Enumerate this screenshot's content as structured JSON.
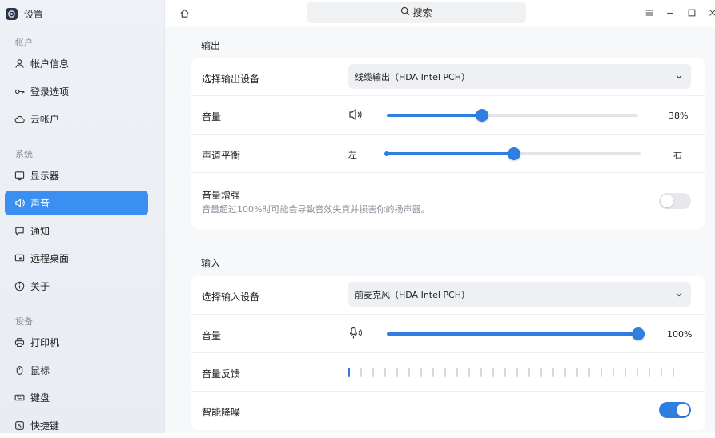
{
  "app": {
    "name": "设置"
  },
  "sidebar": {
    "groups": [
      {
        "label": "帐户",
        "items": [
          {
            "label": "帐户信息",
            "icon": "user-icon"
          },
          {
            "label": "登录选项",
            "icon": "key-icon"
          },
          {
            "label": "云帐户",
            "icon": "cloud-icon"
          }
        ]
      },
      {
        "label": "系统",
        "items": [
          {
            "label": "显示器",
            "icon": "monitor-icon"
          },
          {
            "label": "声音",
            "icon": "speaker-icon",
            "active": true
          },
          {
            "label": "通知",
            "icon": "chat-bubble-icon"
          },
          {
            "label": "远程桌面",
            "icon": "remote-desktop-icon"
          },
          {
            "label": "关于",
            "icon": "info-icon"
          }
        ]
      },
      {
        "label": "设备",
        "items": [
          {
            "label": "打印机",
            "icon": "printer-icon"
          },
          {
            "label": "鼠标",
            "icon": "mouse-icon"
          },
          {
            "label": "键盘",
            "icon": "keyboard-icon"
          },
          {
            "label": "快捷键",
            "icon": "shortcut-icon"
          }
        ]
      }
    ]
  },
  "topbar": {
    "search_placeholder": "搜索"
  },
  "output": {
    "title": "输出",
    "device_label": "选择输出设备",
    "device_value": "线缆输出（HDA Intel PCH）",
    "volume_label": "音量",
    "volume_value": "38%",
    "volume_level": 0.38,
    "balance_label": "声道平衡",
    "balance_left": "左",
    "balance_right": "右",
    "balance_level": 0.5,
    "boost_label": "音量增强",
    "boost_desc": "音量超过100%时可能会导致音效失真并损害你的扬声器。",
    "boost_on": false
  },
  "input": {
    "title": "输入",
    "device_label": "选择输入设备",
    "device_value": "前麦克风（HDA Intel PCH）",
    "volume_label": "音量",
    "volume_value": "100%",
    "volume_level": 1.0,
    "feedback_label": "音量反馈",
    "feedback_level": 1,
    "noise_label": "智能降噪",
    "noise_on": true
  },
  "colors": {
    "accent": "#2f7fe0",
    "active_nav": "#3b8ff0"
  }
}
